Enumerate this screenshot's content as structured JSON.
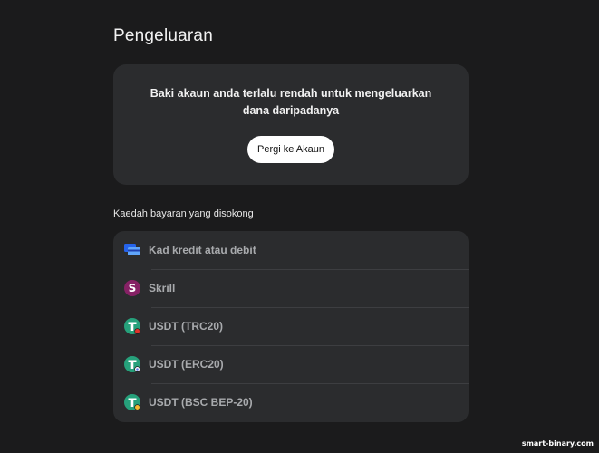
{
  "page": {
    "title": "Pengeluaran"
  },
  "notice": {
    "message": "Baki akaun anda terlalu rendah untuk mengeluarkan dana daripadanya",
    "button_label": "Pergi ke Akaun"
  },
  "payment_methods": {
    "heading": "Kaedah bayaran yang disokong",
    "items": [
      {
        "label": "Kad kredit atau debit",
        "icon": "credit-card-icon"
      },
      {
        "label": "Skrill",
        "icon": "skrill-icon"
      },
      {
        "label": "USDT (TRC20)",
        "icon": "tether-trc20-icon"
      },
      {
        "label": "USDT (ERC20)",
        "icon": "tether-erc20-icon"
      },
      {
        "label": "USDT (BSC BEP-20)",
        "icon": "tether-bep20-icon"
      }
    ]
  },
  "colors": {
    "background": "#1b1b1c",
    "card": "#2b2c2e",
    "skrill": "#862165",
    "tether": "#26a17b",
    "card_icon_blue": "#3b82f6"
  },
  "watermark": "smart-binary.com"
}
